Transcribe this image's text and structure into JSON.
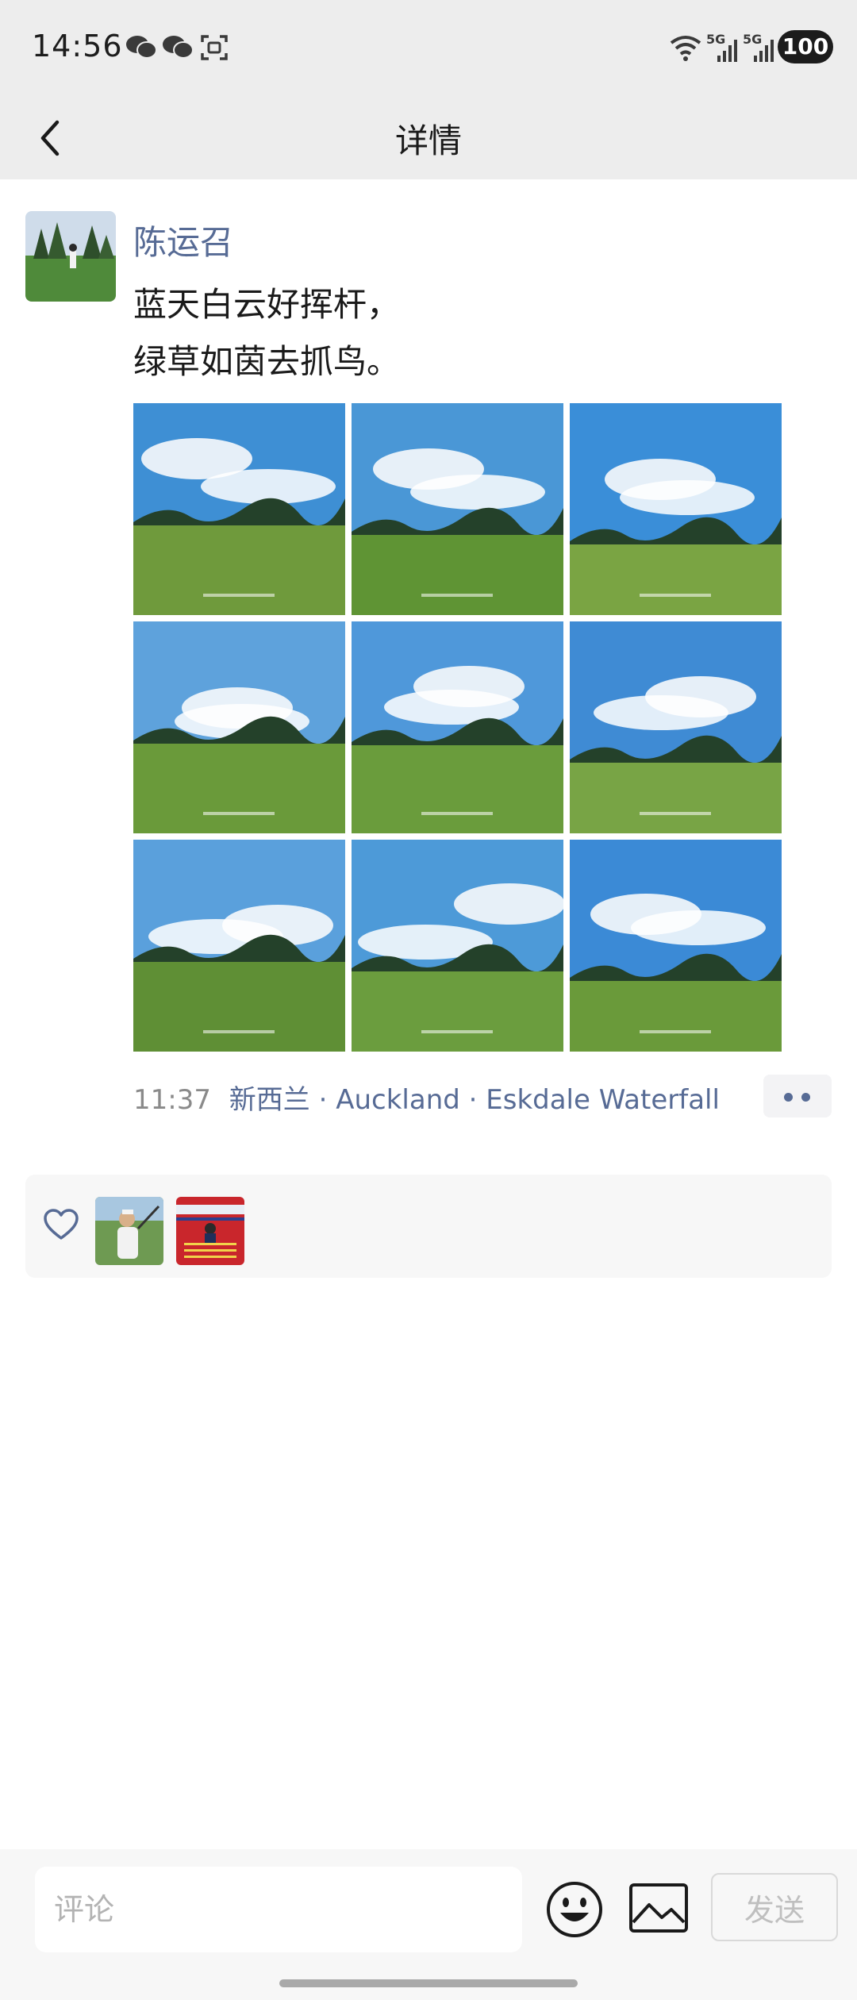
{
  "status_bar": {
    "time": "14:56",
    "network_labels": [
      "5G",
      "5G"
    ],
    "battery": "100",
    "icons": [
      "wechat-icon",
      "wechat-icon",
      "screenshot-icon",
      "wifi-icon",
      "signal-icon",
      "signal-icon"
    ]
  },
  "header": {
    "title": "详情",
    "back_icon": "chevron-left-icon"
  },
  "post": {
    "author": "陈运召",
    "text_lines": [
      "蓝天白云好挥杆，",
      "绿草如茵去抓鸟。"
    ],
    "photos": [
      {
        "alt": "photo-1",
        "sky": "#3e8fd4",
        "grass": "#6f9a3c"
      },
      {
        "alt": "photo-2",
        "sky": "#4a97d6",
        "grass": "#5f9434"
      },
      {
        "alt": "photo-3",
        "sky": "#3a8ed8",
        "grass": "#7aa443"
      },
      {
        "alt": "photo-4",
        "sky": "#5ea2dc",
        "grass": "#6a9a3a"
      },
      {
        "alt": "photo-5",
        "sky": "#4f98da",
        "grass": "#6a9c3c"
      },
      {
        "alt": "photo-6",
        "sky": "#3f8bd4",
        "grass": "#78a445"
      },
      {
        "alt": "photo-7",
        "sky": "#5aa0dc",
        "grass": "#5f8f35"
      },
      {
        "alt": "photo-8",
        "sky": "#4d9ad8",
        "grass": "#6b9d3e"
      },
      {
        "alt": "photo-9",
        "sky": "#3b8ad6",
        "grass": "#6a9a3a"
      }
    ],
    "time": "11:37",
    "location": "新西兰 · Auckland · Eskdale Waterfall",
    "more_icon": "more-dots-icon"
  },
  "likes": {
    "icon": "heart-icon",
    "avatars": [
      "liker-avatar-golfer",
      "liker-avatar-red-banner"
    ]
  },
  "comment_bar": {
    "placeholder": "评论",
    "send_label": "发送",
    "emoji_icon": "emoji-icon",
    "image_icon": "image-icon"
  },
  "colors": {
    "link": "#576b95",
    "header_bg": "#ededed",
    "likes_bg": "#f7f7f7"
  }
}
